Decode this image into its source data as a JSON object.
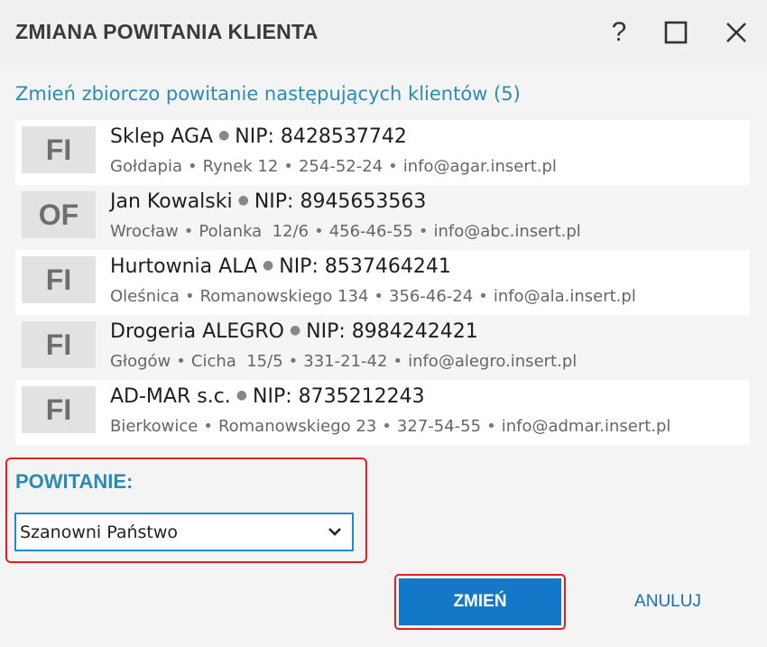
{
  "window": {
    "title": "ZMIANA POWITANIA KLIENTA",
    "help_label": "?"
  },
  "subtitle": "Zmień zbiorczo powitanie następujących klientów (5)",
  "clients": [
    {
      "type": "FI",
      "name": "Sklep AGA",
      "nip": "NIP: 8428537742",
      "city": "Gołdapia",
      "street": "Rynek 12",
      "phone": "254-52-24",
      "email": "info@agar.insert.pl"
    },
    {
      "type": "OF",
      "name": "Jan Kowalski",
      "nip": "NIP: 8945653563",
      "city": "Wrocław",
      "street": "Polanka  12/6",
      "phone": "456-46-55",
      "email": "info@abc.insert.pl"
    },
    {
      "type": "FI",
      "name": "Hurtownia ALA",
      "nip": "NIP: 8537464241",
      "city": "Oleśnica",
      "street": "Romanowskiego 134",
      "phone": "356-46-24",
      "email": "info@ala.insert.pl"
    },
    {
      "type": "FI",
      "name": "Drogeria ALEGRO",
      "nip": "NIP: 8984242421",
      "city": "Głogów",
      "street": "Cicha  15/5",
      "phone": "331-21-42",
      "email": "info@alegro.insert.pl"
    },
    {
      "type": "FI",
      "name": "AD-MAR s.c.",
      "nip": "NIP: 8735212243",
      "city": "Bierkowice",
      "street": "Romanowskiego 23",
      "phone": "327-54-55",
      "email": "info@admar.insert.pl"
    }
  ],
  "greeting": {
    "label": "POWITANIE:",
    "selected": "Szanowni Państwo"
  },
  "buttons": {
    "confirm": "ZMIEŃ",
    "cancel": "ANULUJ"
  },
  "colors": {
    "accent": "#2a8bb5",
    "primary_button": "#1278c7",
    "highlight_border": "#e02020"
  }
}
